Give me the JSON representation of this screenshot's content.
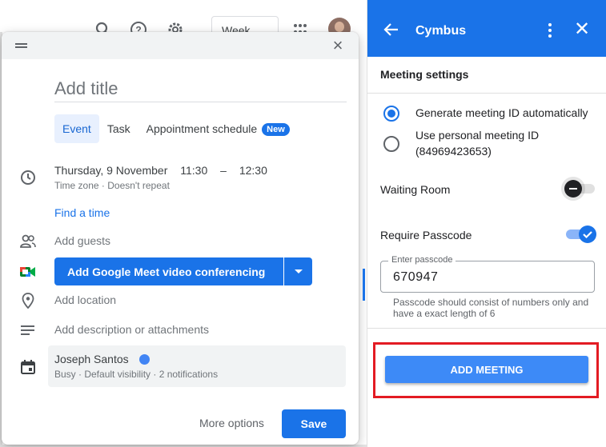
{
  "calendar_header": {
    "view_label": "Week"
  },
  "event_dialog": {
    "title_placeholder": "Add title",
    "tabs": [
      {
        "label": "Event"
      },
      {
        "label": "Task"
      },
      {
        "label": "Appointment schedule"
      }
    ],
    "new_badge": "New",
    "date": "Thursday, 9 November",
    "start_time": "11:30",
    "time_separator": "–",
    "end_time": "12:30",
    "timezone_text": "Time zone · Doesn't repeat",
    "find_time": "Find a time",
    "add_guests": "Add guests",
    "meet_button": "Add Google Meet video conferencing",
    "add_location": "Add location",
    "add_description": "Add description or attachments",
    "owner_name": "Joseph Santos",
    "owner_details": "Busy · Default visibility · 2 notifications",
    "more_options": "More options",
    "save": "Save"
  },
  "side_panel": {
    "title": "Cymbus",
    "section_title": "Meeting settings",
    "radio_options": [
      {
        "label": "Generate meeting ID automatically",
        "selected": true
      },
      {
        "label": "Use personal meeting ID",
        "sub": "(84969423653)",
        "selected": false
      }
    ],
    "waiting_room_label": "Waiting Room",
    "waiting_room_on": false,
    "require_passcode_label": "Require Passcode",
    "require_passcode_on": true,
    "passcode_label": "Enter passcode",
    "passcode_value": "670947",
    "passcode_help": "Passcode should consist of numbers only and have a exact length of 6",
    "add_meeting": "ADD MEETING"
  },
  "colors": {
    "accent": "#1a73e8",
    "highlight": "#e31b23"
  }
}
